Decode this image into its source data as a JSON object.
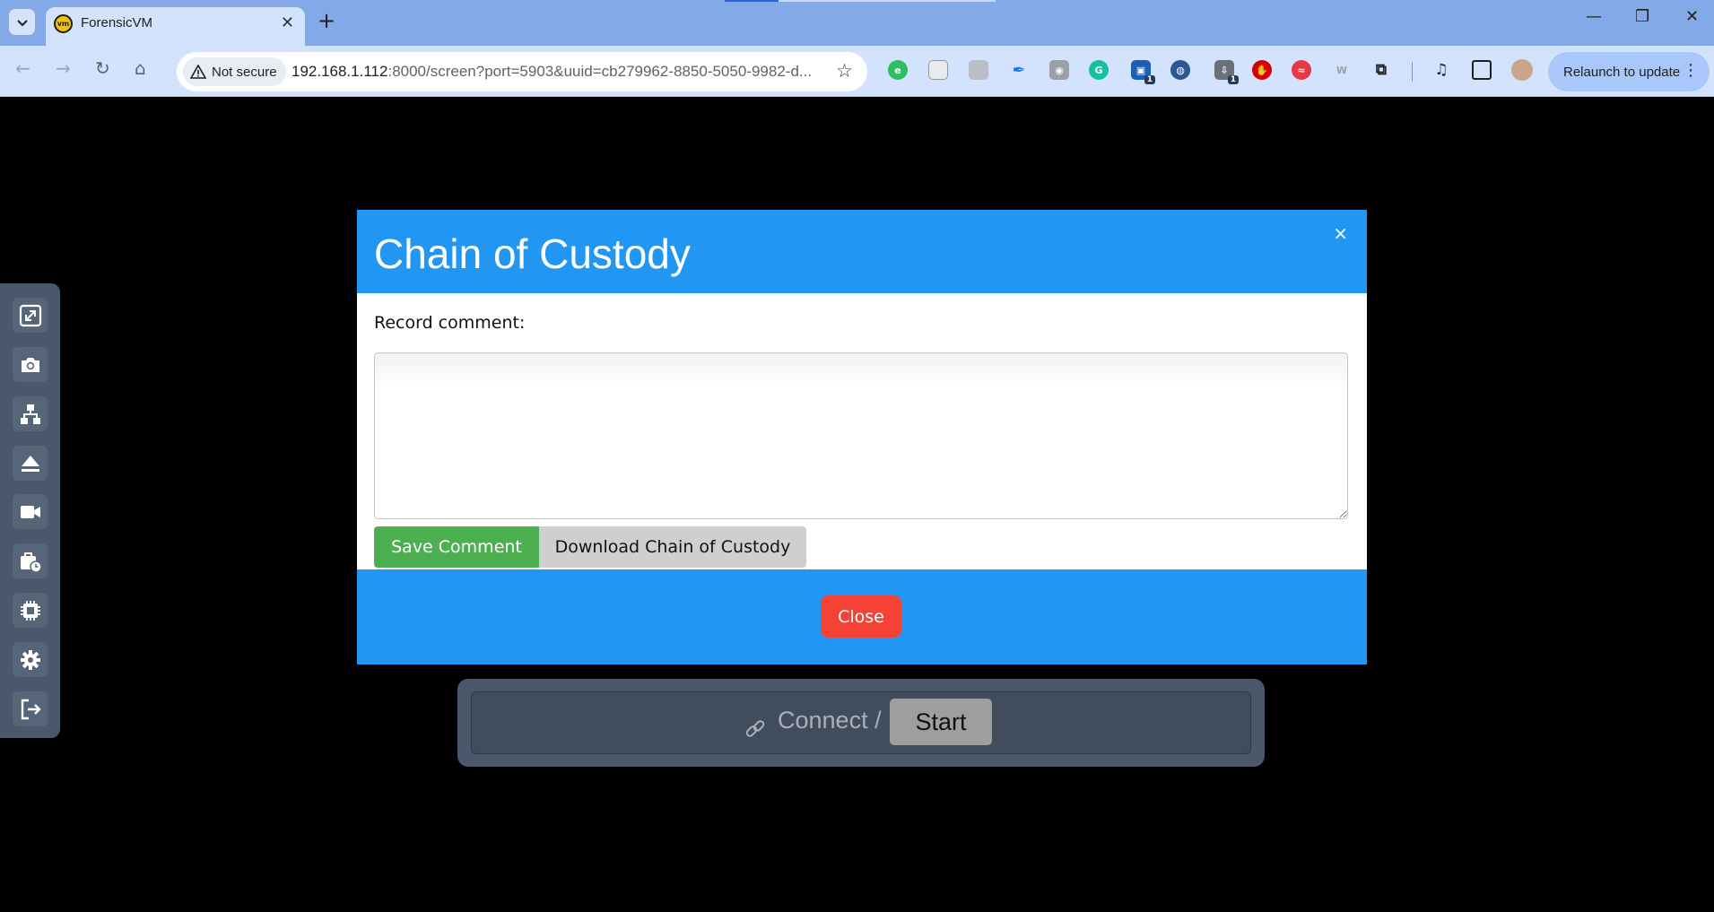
{
  "browser": {
    "tab_title": "ForensicVM",
    "favicon_text": "vm",
    "security_label": "Not secure",
    "url_host": "192.168.1.112",
    "url_rest": ":8000/screen?port=5903&uuid=cb279962-8850-5050-9982-d...",
    "relaunch_label": "Relaunch to update",
    "extension_badges": [
      "1",
      "1"
    ]
  },
  "sidebar": {
    "buttons": [
      "fullscreen-icon",
      "camera-icon",
      "network-icon",
      "eject-icon",
      "video-camera-icon",
      "evidence-clock-icon",
      "cpu-icon",
      "gear-icon",
      "logout-icon"
    ]
  },
  "modal": {
    "title": "Chain of Custody",
    "close_x": "×",
    "comment_label": "Record comment:",
    "comment_value": "",
    "save_label": "Save Comment",
    "download_label": "Download Chain of Custody",
    "close_label": "Close"
  },
  "connect": {
    "text": "Connect /",
    "start_label": "Start"
  },
  "colors": {
    "modal_blue": "#2196f3",
    "save_green": "#4caf50",
    "close_red": "#f44336",
    "panel_bg": "#4a586b"
  }
}
